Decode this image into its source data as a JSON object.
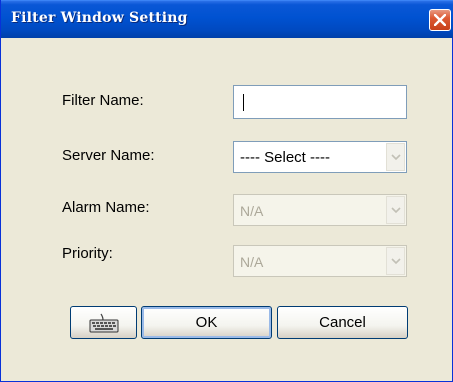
{
  "window": {
    "title": "Filter Window Setting"
  },
  "form": {
    "filter_name_label": "Filter Name:",
    "filter_name_value": "",
    "server_name_label": "Server Name:",
    "server_name_value": "---- Select ----",
    "alarm_name_label": "Alarm Name:",
    "alarm_name_value": "N/A",
    "priority_label": "Priority:",
    "priority_value": "N/A"
  },
  "buttons": {
    "ok_label": "OK",
    "cancel_label": "Cancel",
    "keyboard_icon": "keyboard-icon"
  },
  "colors": {
    "title_bar": "#0052D1",
    "window_bg": "#ECE9D8",
    "close_button": "#DD5A33"
  }
}
